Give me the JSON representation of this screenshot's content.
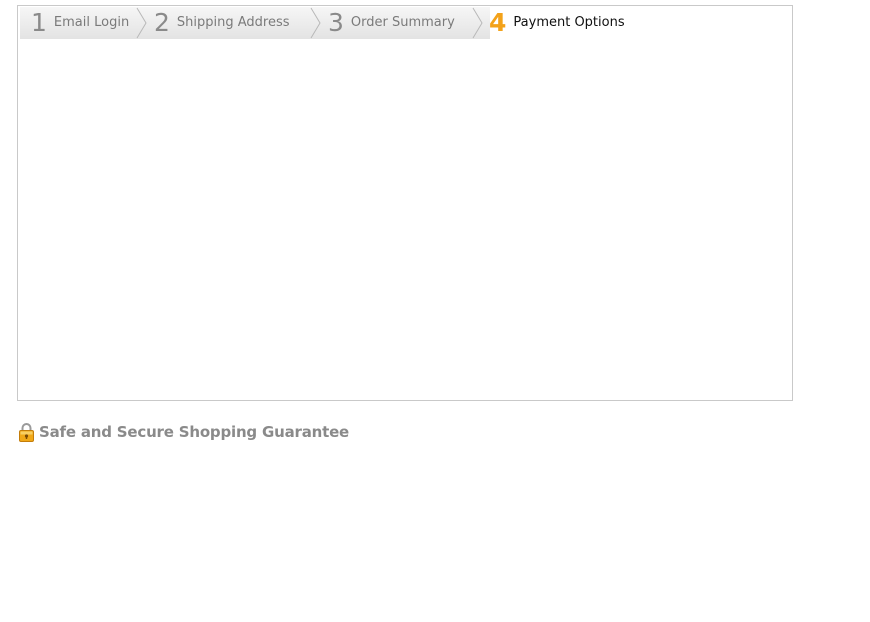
{
  "checkout": {
    "steps": [
      {
        "number": "1",
        "label": "Email Login",
        "state": "complete"
      },
      {
        "number": "2",
        "label": "Shipping Address",
        "state": "complete"
      },
      {
        "number": "3",
        "label": "Order Summary",
        "state": "complete"
      },
      {
        "number": "4",
        "label": "Payment Options",
        "state": "active"
      }
    ],
    "active_color": "#f3a21a"
  },
  "footer": {
    "secure_text": "Safe and Secure Shopping Guarantee",
    "secure_icon": "lock-icon"
  }
}
